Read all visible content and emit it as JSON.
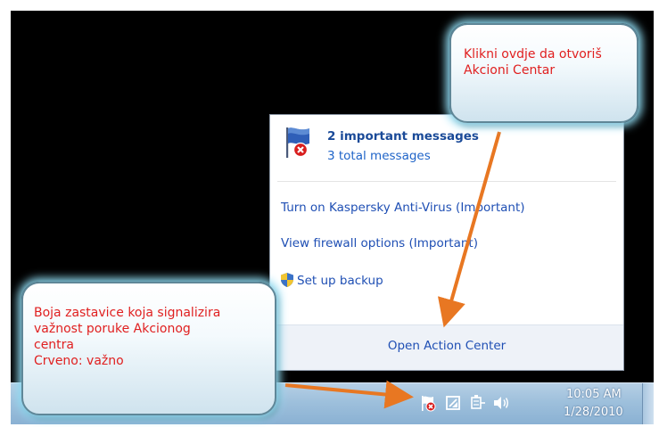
{
  "popup": {
    "title": "2 important messages",
    "subtitle": "3 total messages",
    "links": [
      "Turn on Kaspersky Anti-Virus (Important)",
      "View firewall options (Important)",
      "Set up backup"
    ],
    "open_label": "Open Action Center"
  },
  "taskbar": {
    "time": "10:05 AM",
    "date": "1/28/2010",
    "tray_icons": [
      "action-center-flag-icon",
      "network-icon",
      "power-icon",
      "volume-icon"
    ]
  },
  "callouts": {
    "top": [
      "Klikni ovdje da otvoriš",
      "Akcioni Centar"
    ],
    "bottom": [
      "Boja zastavice koja signalizira",
      "važnost poruke Akcionog",
      "centra",
      "Crveno: važno"
    ]
  },
  "colors": {
    "annotation_text": "#e02020",
    "arrow": "#e87722",
    "link": "#1f4fb4",
    "taskbar": "#9ec0dc",
    "desktop": "#000000"
  }
}
